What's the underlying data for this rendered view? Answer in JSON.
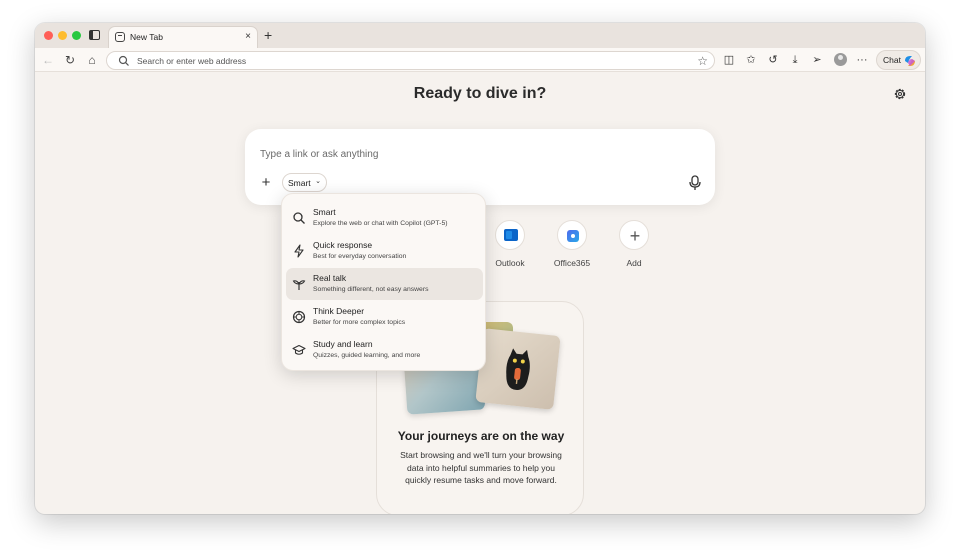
{
  "tab": {
    "title": "New Tab",
    "close": "×",
    "new_tab": "+"
  },
  "address_bar": {
    "placeholder": "Search or enter web address"
  },
  "toolbar": {
    "more": "···",
    "chat_label": "Chat"
  },
  "main": {
    "headline": "Ready to dive in?"
  },
  "prompt": {
    "placeholder": "Type a link or ask anything",
    "plus": "+",
    "mode_label": "Smart",
    "mode_chevron": "⌄"
  },
  "modes": [
    {
      "title": "Smart",
      "desc": "Explore the web or chat with Copilot (GPT-5)",
      "icon": "search-icon"
    },
    {
      "title": "Quick response",
      "desc": "Best for everyday conversation",
      "icon": "lightning-icon"
    },
    {
      "title": "Real talk",
      "desc": "Something different, not easy answers",
      "icon": "sprout-icon"
    },
    {
      "title": "Think Deeper",
      "desc": "Better for more complex topics",
      "icon": "brain-icon"
    },
    {
      "title": "Study and learn",
      "desc": "Quizzes, guided learning, and more",
      "icon": "graduation-cap-icon"
    }
  ],
  "selected_mode": "Real talk",
  "shortcuts": [
    {
      "label": "Outlook",
      "icon": "outlook-icon"
    },
    {
      "label": "Office365",
      "icon": "office365-icon"
    },
    {
      "label": "Add",
      "icon": "plus-icon"
    }
  ],
  "journeys": {
    "title": "Your journeys are on the way",
    "body": "Start browsing and we'll turn your browsing data into helpful summaries to help you quickly resume tasks and move forward."
  },
  "colors": {
    "accent_red": "#ff5f57",
    "accent_yellow": "#febc2e",
    "accent_green": "#28c840",
    "outlook_blue": "#0a64c8",
    "page_bg": "#f6f2ee"
  }
}
